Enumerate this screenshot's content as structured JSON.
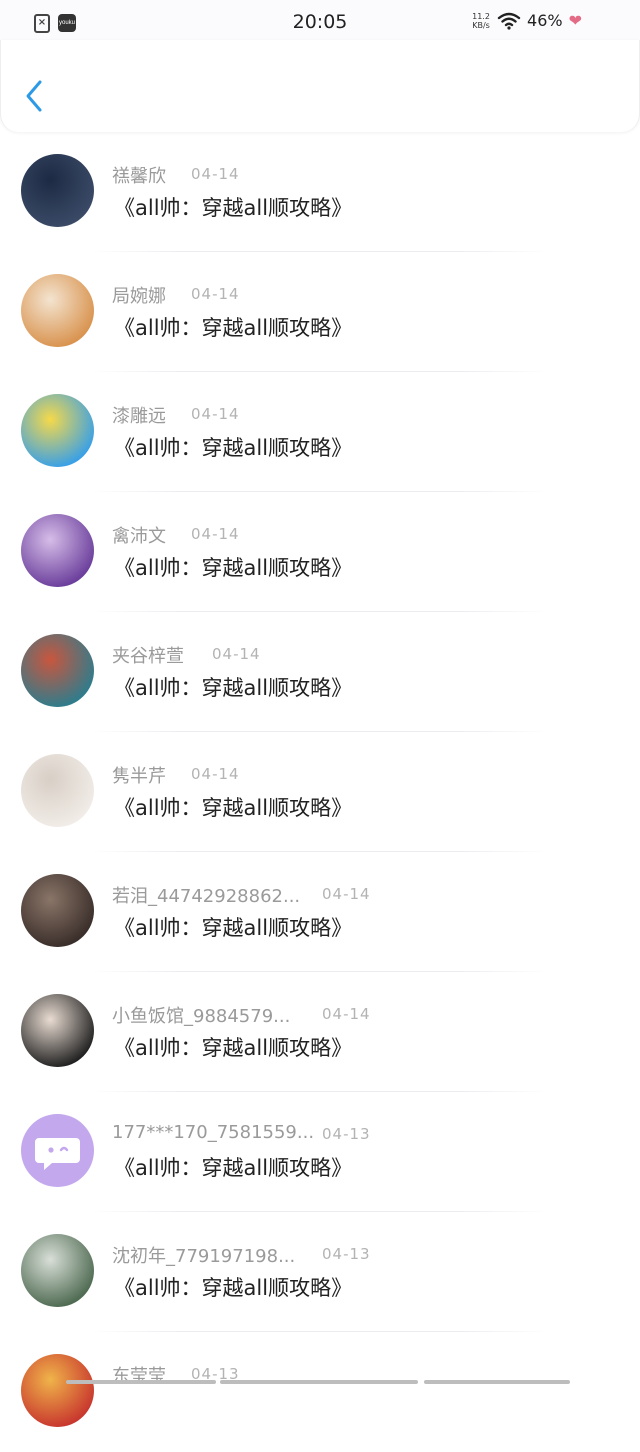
{
  "status_bar": {
    "time": "20:05",
    "net_speed_top": "11.2",
    "net_speed_bottom": "KB/s",
    "battery": "46%",
    "app_icon_label": "youku"
  },
  "header": {
    "back_icon": "chevron-left-icon"
  },
  "comments": [
    {
      "name": "禚馨欣",
      "date": "04-14",
      "message": "《all帅：穿越all顺攻略》",
      "avatar": "man-photo",
      "avatar_colors": [
        "#3a4a66",
        "#1d2a44"
      ]
    },
    {
      "name": "局婉娜",
      "date": "04-14",
      "message": "《all帅：穿越all顺攻略》",
      "avatar": "shiba-dog",
      "avatar_colors": [
        "#d9934f",
        "#f3e4d0"
      ]
    },
    {
      "name": "漆雕远",
      "date": "04-14",
      "message": "《all帅：穿越all顺攻略》",
      "avatar": "qq-penguin",
      "avatar_colors": [
        "#3aa0e6",
        "#f6d94a"
      ]
    },
    {
      "name": "禽沛文",
      "date": "04-14",
      "message": "《all帅：穿越all顺攻略》",
      "avatar": "anime-girl-purple",
      "avatar_colors": [
        "#6b3f9c",
        "#d6bde8"
      ]
    },
    {
      "name": "夹谷梓萱",
      "date": "04-14",
      "message": "《all帅：穿越all顺攻略》",
      "avatar": "anime-couple",
      "avatar_colors": [
        "#2f7c8c",
        "#c9563e"
      ]
    },
    {
      "name": "隽半芹",
      "date": "04-14",
      "message": "《all帅：穿越all顺攻略》",
      "avatar": "white-cat",
      "avatar_colors": [
        "#f1ece7",
        "#d8cfc6"
      ]
    },
    {
      "name": "若泪_44742928862...",
      "date": "04-14",
      "message": "《all帅：穿越all顺攻略》",
      "avatar": "dark-photo",
      "avatar_colors": [
        "#3a2e2a",
        "#8a7568"
      ]
    },
    {
      "name": "小鱼饭馆_9884579...",
      "date": "04-14",
      "message": "《all帅：穿越all顺攻略》",
      "avatar": "young-man",
      "avatar_colors": [
        "#222222",
        "#e9dcd2"
      ]
    },
    {
      "name": "177***170_7581559...",
      "date": "04-13",
      "message": "《all帅：穿越all顺攻略》",
      "avatar": "default-chat-avatar",
      "avatar_colors": [
        "#c3a8ee",
        "#ffffff"
      ]
    },
    {
      "name": "沈初年_779197198...",
      "date": "04-13",
      "message": "《all帅：穿越all顺攻略》",
      "avatar": "ink-painting",
      "avatar_colors": [
        "#4f6b52",
        "#d9dfd8"
      ]
    },
    {
      "name": "东莹莹",
      "date": "04-13",
      "message": "",
      "avatar": "red-flower",
      "avatar_colors": [
        "#c8372e",
        "#f0b44a"
      ]
    }
  ]
}
